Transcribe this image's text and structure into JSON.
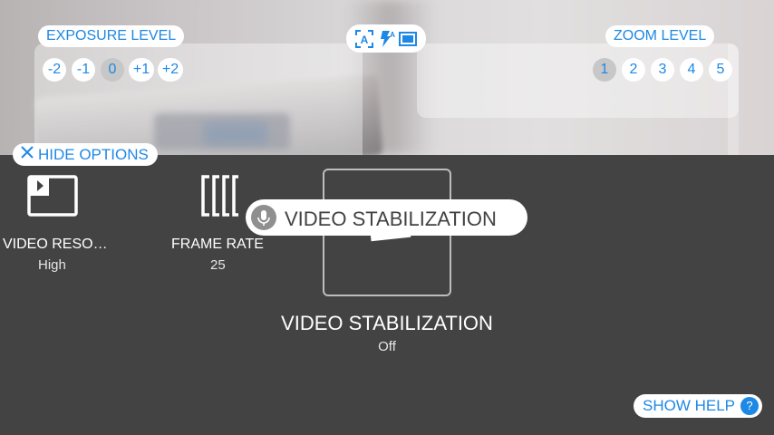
{
  "exposure": {
    "label": "EXPOSURE LEVEL",
    "options": [
      "-2",
      "-1",
      "0",
      "+1",
      "+2"
    ],
    "selected": "0"
  },
  "zoom": {
    "label": "ZOOM LEVEL",
    "options": [
      "1",
      "2",
      "3",
      "4",
      "5"
    ],
    "selected": "1"
  },
  "mode_icons": [
    "auto-focus-icon",
    "flash-auto-icon",
    "aspect-ratio-icon"
  ],
  "hide_options": {
    "label": "HIDE OPTIONS",
    "icon": "close-icon"
  },
  "options": {
    "resolution": {
      "label": "VIDEO RESO…",
      "value": "High",
      "icon": "video-resolution-icon"
    },
    "frame_rate": {
      "label": "FRAME RATE",
      "value": "25",
      "icon": "frame-rate-icon"
    },
    "stabilization": {
      "label": "VIDEO STABILIZATION",
      "value": "Off",
      "icon": "video-stabilization-icon"
    }
  },
  "voice_tooltip": {
    "text": "VIDEO STABILIZATION",
    "icon": "microphone-icon"
  },
  "help": {
    "label": "SHOW HELP",
    "icon_text": "?"
  },
  "colors": {
    "accent": "#1e88e5",
    "panel_bg": "#434343",
    "selected_chip": "#c7c7c7"
  }
}
